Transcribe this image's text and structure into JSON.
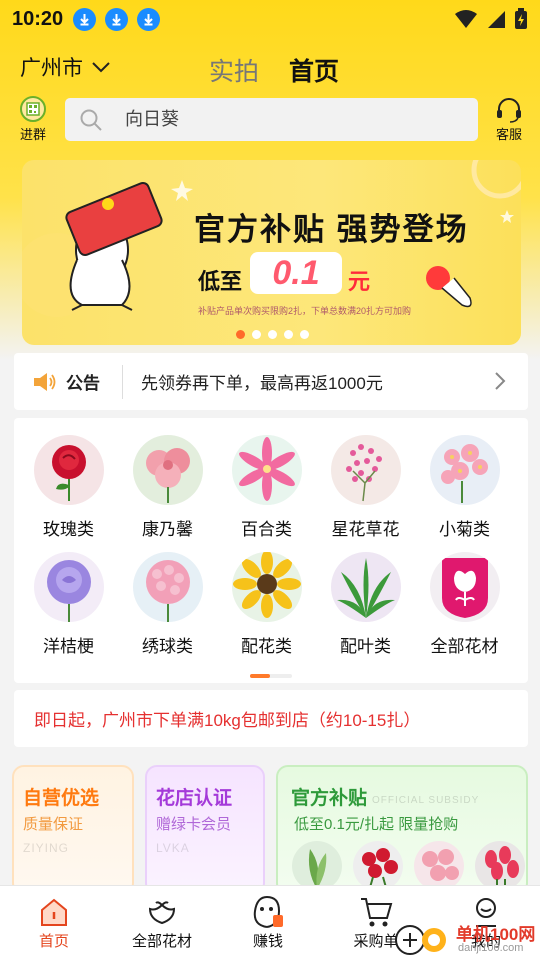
{
  "status_bar": {
    "time": "10:20"
  },
  "header": {
    "city": "广州市",
    "tabs": [
      "实拍",
      "首页"
    ],
    "active_tab": "首页"
  },
  "search": {
    "left_label": "进群",
    "placeholder": "向日葵",
    "right_label": "客服"
  },
  "banner": {
    "title": "官方补贴 强势登场",
    "low_prefix": "低至",
    "price": "0.1",
    "unit": "元",
    "note": "补贴产品单次购买限购2扎，下单总数满20扎方可加购",
    "dots": 5,
    "active_dot": 0
  },
  "notice": {
    "label": "公告",
    "text": "先领券再下单，最高再返1000元"
  },
  "categories": [
    {
      "label": "玫瑰类",
      "icon": "rose"
    },
    {
      "label": "康乃馨",
      "icon": "carnation"
    },
    {
      "label": "百合类",
      "icon": "lily"
    },
    {
      "label": "星花草花",
      "icon": "gypsophila"
    },
    {
      "label": "小菊类",
      "icon": "daisy"
    },
    {
      "label": "洋桔梗",
      "icon": "eustoma"
    },
    {
      "label": "绣球类",
      "icon": "hydrangea"
    },
    {
      "label": "配花类",
      "icon": "sunflower"
    },
    {
      "label": "配叶类",
      "icon": "leaves"
    },
    {
      "label": "全部花材",
      "icon": "all-flowers"
    }
  ],
  "promo": {
    "text": "即日起，广州市下单满10kg包邮到店（约10-15扎）"
  },
  "cards": [
    {
      "title": "自营优选",
      "subtitle": "质量保证",
      "watermark": "ZIYING"
    },
    {
      "title": "花店认证",
      "subtitle": "赠绿卡会员",
      "watermark": "LVKA"
    },
    {
      "title": "官方补贴",
      "subtitle": "低至0.1元/扎起   限量抢购",
      "watermark": "OFFICIAL SUBSIDY"
    }
  ],
  "bottom_nav": [
    {
      "label": "首页",
      "icon": "home-icon",
      "active": true
    },
    {
      "label": "全部花材",
      "icon": "flower-icon",
      "active": false
    },
    {
      "label": "赚钱",
      "icon": "money-icon",
      "active": false
    },
    {
      "label": "采购单",
      "icon": "cart-icon",
      "active": false
    },
    {
      "label": "我的",
      "icon": "user-icon",
      "active": false
    }
  ],
  "watermark": {
    "text": "单机100网",
    "url": "danji100.com"
  },
  "colors": {
    "accent": "#ffd91a",
    "active": "#e4451e",
    "notice_red": "#e53030"
  }
}
